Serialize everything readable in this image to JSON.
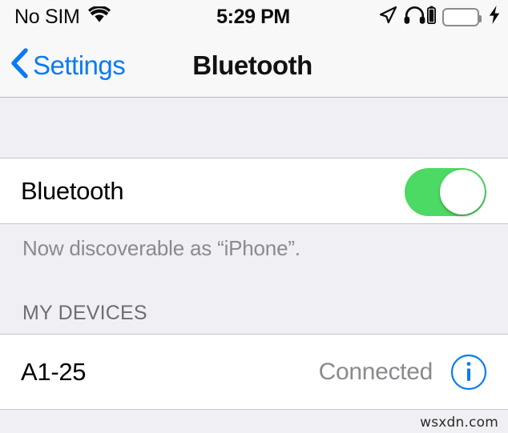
{
  "status_bar": {
    "carrier": "No SIM",
    "wifi_icon": "wifi-icon",
    "time": "5:29 PM",
    "location_icon": "location-arrow-icon",
    "headphones_icon": "headphones-icon",
    "headphone_battery_icon": "headphone-battery-icon",
    "battery_icon": "battery-icon",
    "charging_icon": "charging-bolt-icon",
    "battery_color": "#4CD964"
  },
  "nav_bar": {
    "back_icon": "chevron-left-icon",
    "back_label": "Settings",
    "title": "Bluetooth",
    "tint_color": "#0A7BF2"
  },
  "content": {
    "bluetooth_row": {
      "label": "Bluetooth",
      "toggle_state": "on",
      "toggle_on_color": "#4CD964"
    },
    "discoverable_note": "Now discoverable as “iPhone”.",
    "section_header": "MY DEVICES",
    "devices": [
      {
        "name": "A1-25",
        "status": "Connected",
        "info_icon": "info-circle-icon"
      }
    ]
  },
  "watermark": "wsxdn.com"
}
